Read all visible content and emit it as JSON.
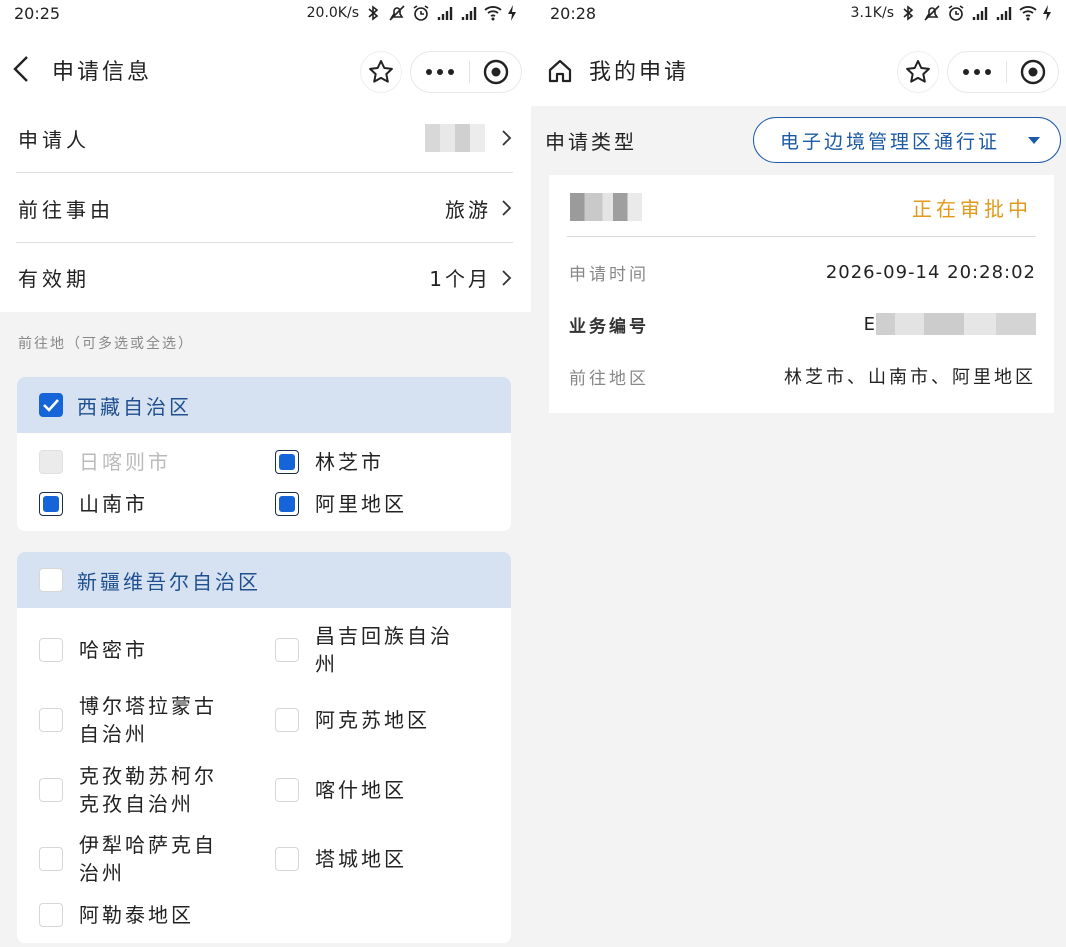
{
  "left": {
    "status": {
      "time": "20:25",
      "speed": "20.0K/s"
    },
    "nav": {
      "title": "申请信息"
    },
    "form": {
      "applicant_label": "申请人",
      "reason_label": "前往事由",
      "reason_value": "旅游",
      "validity_label": "有效期",
      "validity_value": "1个月"
    },
    "destination_hint": "前往地（可多选或全选）",
    "regions": [
      {
        "name": "西藏自治区",
        "checked": true,
        "items": [
          {
            "label": "日喀则市",
            "state": "disabled"
          },
          {
            "label": "林芝市",
            "state": "checked"
          },
          {
            "label": "山南市",
            "state": "checked"
          },
          {
            "label": "阿里地区",
            "state": "checked"
          }
        ]
      },
      {
        "name": "新疆维吾尔自治区",
        "checked": false,
        "items": [
          {
            "label": "哈密市",
            "state": "unchecked"
          },
          {
            "label": "昌吉回族自治州",
            "state": "unchecked"
          },
          {
            "label": "博尔塔拉蒙古自治州",
            "state": "unchecked"
          },
          {
            "label": "阿克苏地区",
            "state": "unchecked"
          },
          {
            "label": "克孜勒苏柯尔克孜自治州",
            "state": "unchecked"
          },
          {
            "label": "喀什地区",
            "state": "unchecked"
          },
          {
            "label": "伊犁哈萨克自治州",
            "state": "unchecked"
          },
          {
            "label": "塔城地区",
            "state": "unchecked"
          },
          {
            "label": "阿勒泰地区",
            "state": "unchecked"
          }
        ]
      }
    ]
  },
  "right": {
    "status": {
      "time": "20:28",
      "speed": "3.1K/s"
    },
    "nav": {
      "title": "我的申请"
    },
    "type_label": "申请类型",
    "type_value": "电子边境管理区通行证",
    "card": {
      "status": "正在审批中",
      "apply_time_label": "申请时间",
      "apply_time_value": "2026-09-14 20:28:02",
      "biz_no_label": "业务编号",
      "biz_no_prefix": "E",
      "dest_label": "前往地区",
      "dest_value": "林芝市、山南市、阿里地区"
    }
  },
  "colors": {
    "accent": "#1565d8",
    "header_bg": "#d6e2f1",
    "status_orange": "#e19a1d",
    "pill_blue": "#1d5aa6"
  }
}
